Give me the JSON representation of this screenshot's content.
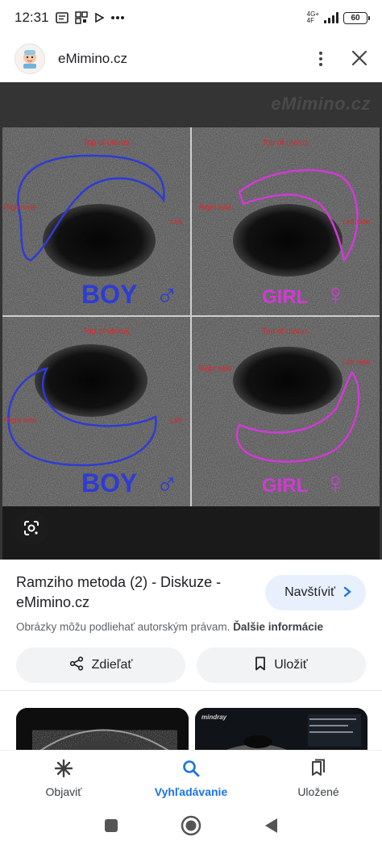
{
  "status_bar": {
    "time": "12:31",
    "network": "4G+",
    "network_sub": "4F",
    "battery": "60"
  },
  "header": {
    "site_name": "eMimino.cz"
  },
  "viewer": {
    "watermark": "eMimino.cz",
    "quadrants": [
      {
        "gender": "BOY",
        "symbol": "♂",
        "color": "#2e3bd6",
        "top_label": "Top of uterus",
        "left_label": "Right side",
        "right_label": "Left"
      },
      {
        "gender": "GIRL",
        "symbol": "♀",
        "color": "#d23ad6",
        "top_label": "Top of uterus",
        "left_label": "Right side",
        "right_label": "Left side"
      },
      {
        "gender": "BOY",
        "symbol": "♂",
        "color": "#2e3bd6",
        "top_label": "Top of uterus",
        "left_label": "Right side",
        "right_label": "Left"
      },
      {
        "gender": "GIRL",
        "symbol": "♀",
        "color": "#d23ad6",
        "top_label": "Top of uterus",
        "left_label": "Right side",
        "right_label": "Left side"
      }
    ]
  },
  "info": {
    "title": "Ramziho metoda (2) - Diskuze - eMimino.cz",
    "visit_label": "Navštíviť",
    "rights_text": "Obrázky môžu podliehať autorským právam.",
    "more_info": "Ďalšie informácie",
    "share_label": "Zdieľať",
    "save_label": "Uložiť"
  },
  "thumb2": {
    "brand": "mindray"
  },
  "bottom_nav": {
    "items": [
      {
        "label": "Objaviť"
      },
      {
        "label": "Vyhľadávanie"
      },
      {
        "label": "Uložené"
      }
    ]
  },
  "colors": {
    "accent": "#1a73e8",
    "visit_bg": "#e8f0fe",
    "boy": "#2e3bd6",
    "girl": "#d23ad6",
    "label_red": "#e0262a"
  }
}
